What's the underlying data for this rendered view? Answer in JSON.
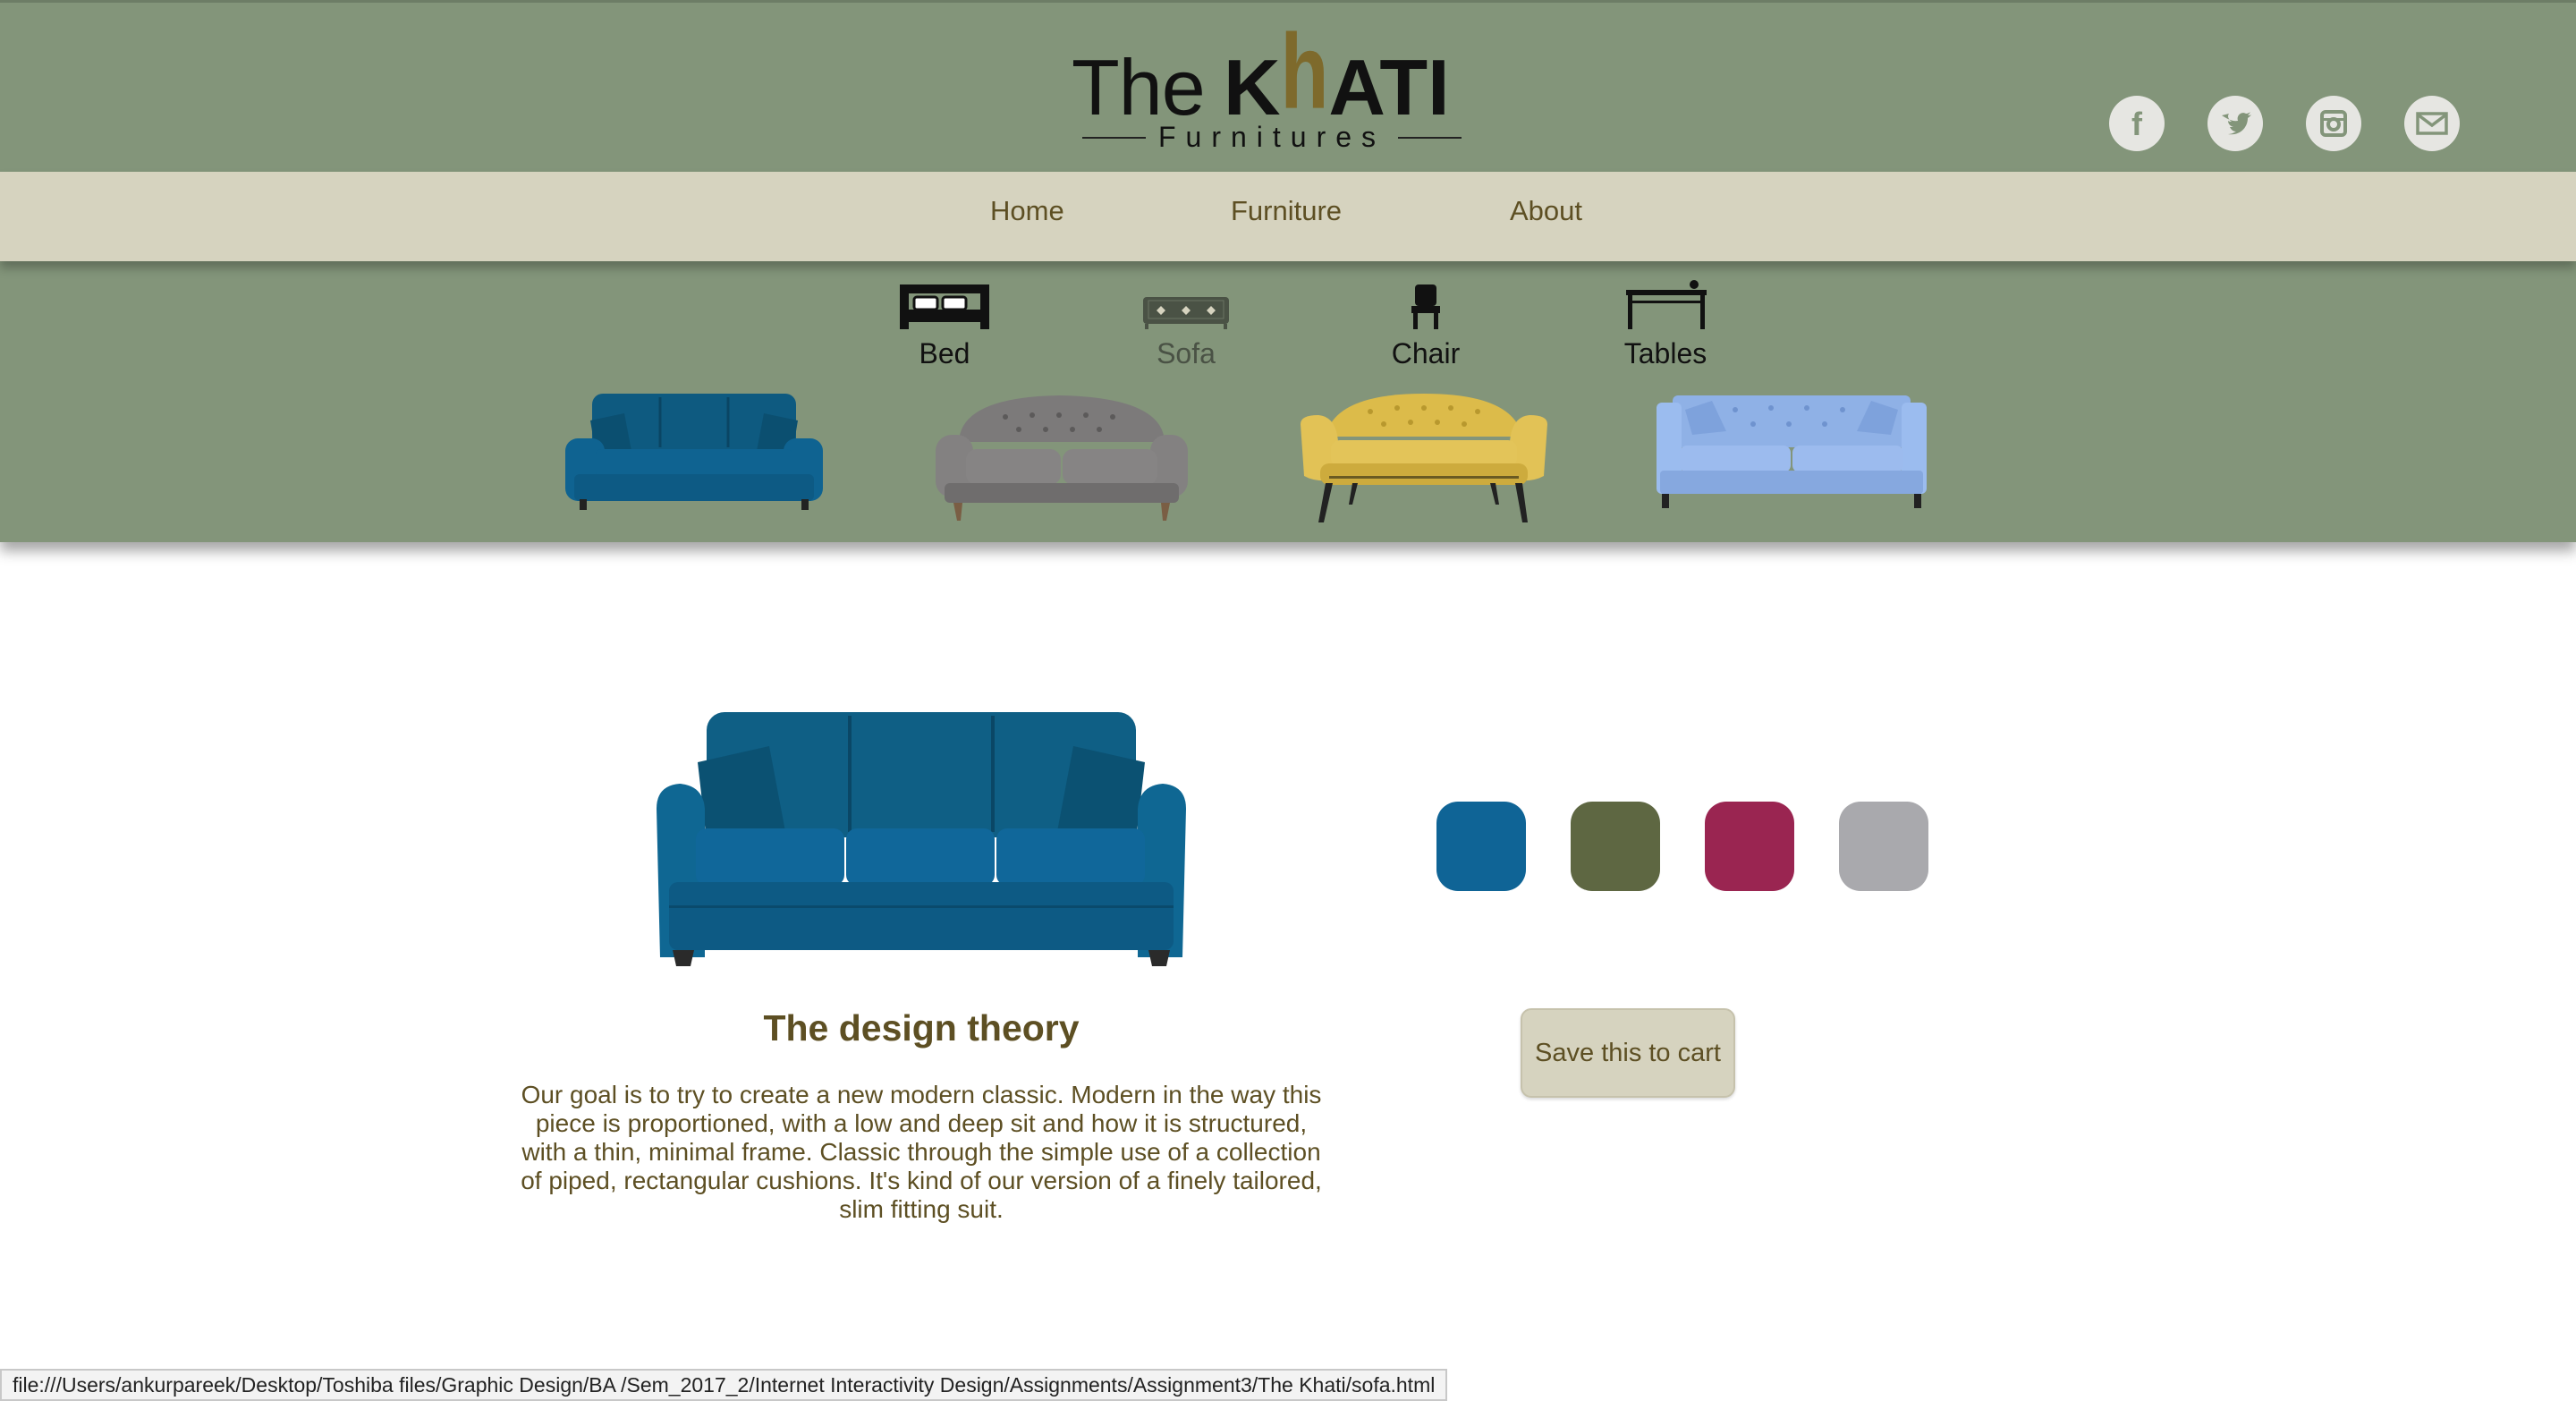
{
  "brand": {
    "the": "The",
    "khati_pre": "K",
    "khati_h": "h",
    "khati_post": "ATI",
    "sub": "Furnitures"
  },
  "social": [
    {
      "name": "facebook",
      "glyph": "f"
    },
    {
      "name": "twitter",
      "glyph": "t"
    },
    {
      "name": "instagram",
      "glyph": "◘"
    },
    {
      "name": "mail",
      "glyph": "✉"
    }
  ],
  "nav": {
    "home": "Home",
    "furniture": "Furniture",
    "about": "About"
  },
  "categories": {
    "bed": "Bed",
    "sofa": "Sofa",
    "chair": "Chair",
    "tables": "Tables",
    "active": "sofa"
  },
  "thumbnails": [
    {
      "name": "teal-sofa",
      "color": "#0e5a80"
    },
    {
      "name": "grey-sofa",
      "color": "#7c7a7a"
    },
    {
      "name": "yellow-sofa",
      "color": "#d9b848"
    },
    {
      "name": "blue-sofa",
      "color": "#8fb1e6"
    }
  ],
  "main": {
    "title": "The design theory",
    "body": "Our goal is to try to create a new modern classic. Modern in the way this piece is proportioned, with a low and deep sit and how it is structured, with a thin, minimal frame. Classic through the simple use of a collection of piped, rectangular cushions. It's kind of our version of a finely tailored, slim fitting suit.",
    "swatches": [
      "#0f6496",
      "#5e6742",
      "#9a2551",
      "#a9a9ad"
    ],
    "cart_button": "Save this to cart"
  },
  "status_bar": "file:///Users/ankurpareek/Desktop/Toshiba files/Graphic Design/BA /Sem_2017_2/Internet Interactivity Design/Assignments/Assignment3/The Khati/sofa.html",
  "colors": {
    "header_green": "#83957a",
    "nav_beige": "#d6d3bf",
    "text_brown": "#5d4f23"
  }
}
